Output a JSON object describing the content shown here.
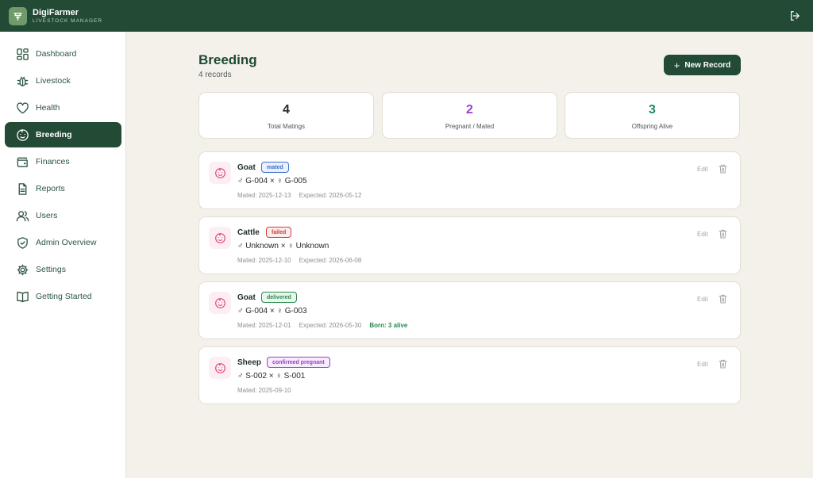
{
  "app": {
    "brand_name": "DigiFarmer",
    "brand_sub": "LIVESTOCK MANAGER"
  },
  "colors": {
    "primary": "#224a35",
    "background": "#f4f1eb",
    "pregnant_accent": "#9b3fd4",
    "offspring_accent": "#1f8a5c"
  },
  "sidebar": {
    "items": [
      {
        "label": "Dashboard",
        "icon": "dashboard-icon"
      },
      {
        "label": "Livestock",
        "icon": "bug-icon"
      },
      {
        "label": "Health",
        "icon": "heart-icon"
      },
      {
        "label": "Breeding",
        "icon": "baby-icon",
        "active": true
      },
      {
        "label": "Finances",
        "icon": "wallet-icon"
      },
      {
        "label": "Reports",
        "icon": "document-icon"
      },
      {
        "label": "Users",
        "icon": "users-icon"
      },
      {
        "label": "Admin Overview",
        "icon": "shield-check-icon"
      },
      {
        "label": "Settings",
        "icon": "gear-icon"
      },
      {
        "label": "Getting Started",
        "icon": "book-open-icon"
      }
    ]
  },
  "header": {
    "title": "Breeding",
    "subtitle": "4 records",
    "new_button_label": "New Record"
  },
  "stats": [
    {
      "value": "4",
      "label": "Total Matings"
    },
    {
      "value": "2",
      "label": "Pregnant / Mated"
    },
    {
      "value": "3",
      "label": "Offspring Alive"
    }
  ],
  "records": [
    {
      "species": "Goat",
      "status": "mated",
      "pair": "♂ G-004 × ♀ G-005",
      "mated": "Mated: 2025-12-13",
      "expected": "Expected: 2026-05-12",
      "born": ""
    },
    {
      "species": "Cattle",
      "status": "failed",
      "pair": "♂ Unknown × ♀ Unknown",
      "mated": "Mated: 2025-12-10",
      "expected": "Expected: 2026-06-08",
      "born": ""
    },
    {
      "species": "Goat",
      "status": "delivered",
      "pair": "♂ G-004 × ♀ G-003",
      "mated": "Mated: 2025-12-01",
      "expected": "Expected: 2026-05-30",
      "born": "Born: 3 alive"
    },
    {
      "species": "Sheep",
      "status": "confirmed pregnant",
      "pair": "♂ S-002 × ♀ S-001",
      "mated": "Mated: 2025-09-10",
      "expected": "",
      "born": ""
    }
  ],
  "edit_label": "Edit"
}
